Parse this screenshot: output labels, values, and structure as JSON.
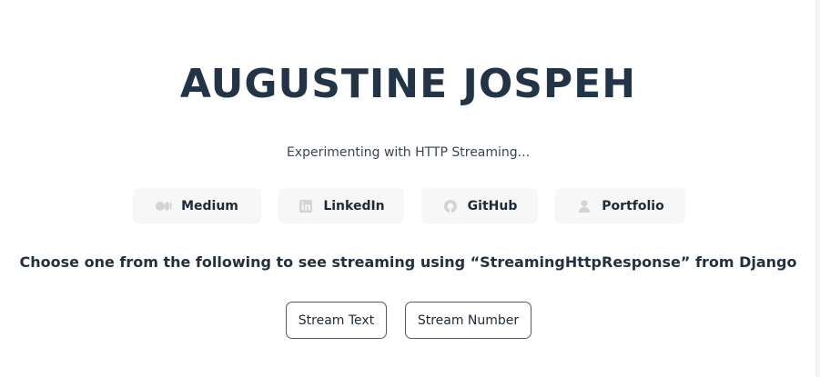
{
  "header": {
    "title": "AUGUSTINE JOSPEH",
    "subtitle": "Experimenting with HTTP Streaming..."
  },
  "links": [
    {
      "label": "Medium",
      "icon": "medium-icon"
    },
    {
      "label": "LinkedIn",
      "icon": "linkedin-icon"
    },
    {
      "label": "GitHub",
      "icon": "github-icon"
    },
    {
      "label": "Portfolio",
      "icon": "portfolio-icon"
    }
  ],
  "main": {
    "prompt": "Choose one from the following to see streaming using “StreamingHttpResponse” from Django",
    "buttons": {
      "stream_text": "Stream Text",
      "stream_number": "Stream Number"
    }
  },
  "colors": {
    "title": "#233446",
    "text": "#22303f",
    "link_bg": "#f7f7f7",
    "button_border": "#5a5a5a"
  }
}
